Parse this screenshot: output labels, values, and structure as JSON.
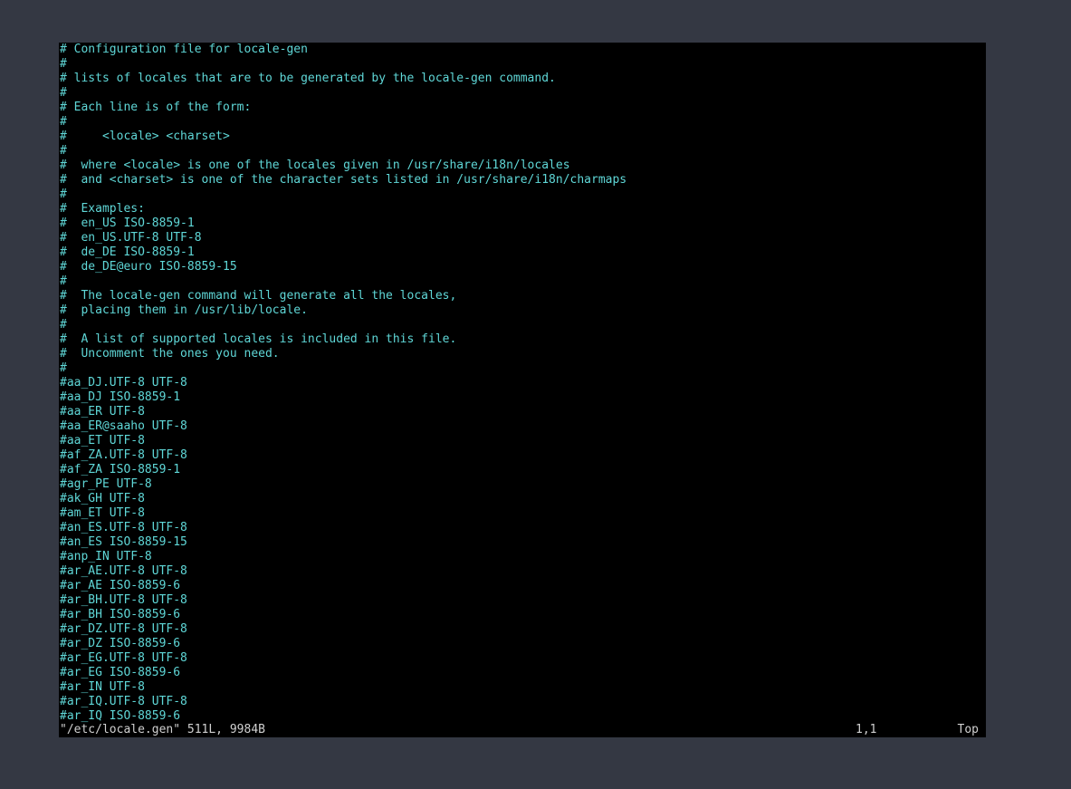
{
  "editor": {
    "lines": [
      "# Configuration file for locale-gen",
      "#",
      "# lists of locales that are to be generated by the locale-gen command.",
      "#",
      "# Each line is of the form:",
      "#",
      "#     <locale> <charset>",
      "#",
      "#  where <locale> is one of the locales given in /usr/share/i18n/locales",
      "#  and <charset> is one of the character sets listed in /usr/share/i18n/charmaps",
      "#",
      "#  Examples:",
      "#  en_US ISO-8859-1",
      "#  en_US.UTF-8 UTF-8",
      "#  de_DE ISO-8859-1",
      "#  de_DE@euro ISO-8859-15",
      "#",
      "#  The locale-gen command will generate all the locales,",
      "#  placing them in /usr/lib/locale.",
      "#",
      "#  A list of supported locales is included in this file.",
      "#  Uncomment the ones you need.",
      "#",
      "#aa_DJ.UTF-8 UTF-8",
      "#aa_DJ ISO-8859-1",
      "#aa_ER UTF-8",
      "#aa_ER@saaho UTF-8",
      "#aa_ET UTF-8",
      "#af_ZA.UTF-8 UTF-8",
      "#af_ZA ISO-8859-1",
      "#agr_PE UTF-8",
      "#ak_GH UTF-8",
      "#am_ET UTF-8",
      "#an_ES.UTF-8 UTF-8",
      "#an_ES ISO-8859-15",
      "#anp_IN UTF-8",
      "#ar_AE.UTF-8 UTF-8",
      "#ar_AE ISO-8859-6",
      "#ar_BH.UTF-8 UTF-8",
      "#ar_BH ISO-8859-6",
      "#ar_DZ.UTF-8 UTF-8",
      "#ar_DZ ISO-8859-6",
      "#ar_EG.UTF-8 UTF-8",
      "#ar_EG ISO-8859-6",
      "#ar_IN UTF-8",
      "#ar_IQ.UTF-8 UTF-8",
      "#ar_IQ ISO-8859-6"
    ]
  },
  "status": {
    "file_info": "\"/etc/locale.gen\" 511L, 9984B",
    "cursor_position": "1,1",
    "scroll_position": "Top"
  },
  "colors": {
    "text": "#5fd7d7",
    "background": "#000000",
    "desktop": "#343843",
    "status_text": "#d0d0d0"
  }
}
